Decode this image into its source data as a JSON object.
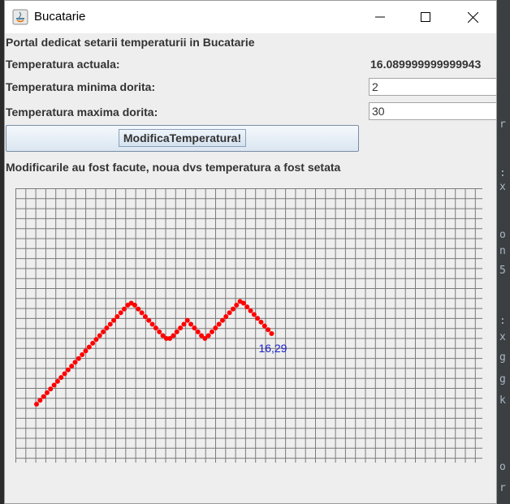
{
  "window": {
    "title": "Bucatarie",
    "buttons": [
      "minimize-icon",
      "maximize-icon",
      "close-icon"
    ]
  },
  "header": "Portal dedicat setarii temperaturii in Bucatarie",
  "current_temp": {
    "label": "Temperatura actuala:",
    "value": "16.089999999999943"
  },
  "min_temp": {
    "label": "Temperatura minima dorita:",
    "value": "2"
  },
  "max_temp": {
    "label": "Temperatura maxima dorita:",
    "value": "30"
  },
  "button": {
    "label": "ModificaTemperatura!"
  },
  "status": "Modificarile au fost facute, noua dvs temperatura a fost setata",
  "colors": {
    "point": "#ff0000",
    "label": "#1a22cc",
    "grid": "#7a7a7a",
    "window_bg": "#eeeeee"
  },
  "chart_data": {
    "type": "line",
    "grid": true,
    "series": [
      {
        "values": [
          0.0,
          0.55,
          1.1,
          1.65,
          2.2,
          2.75,
          3.3,
          3.85,
          4.4,
          4.95,
          5.5,
          6.05,
          6.6,
          7.15,
          7.7,
          8.25,
          8.8,
          9.35,
          9.9,
          10.45,
          11.0,
          11.55,
          12.1,
          12.65,
          13.2,
          13.75,
          14.3,
          14.6,
          14.3,
          13.75,
          13.2,
          12.65,
          12.1,
          11.55,
          11.0,
          10.45,
          9.9,
          9.5,
          9.5,
          9.9,
          10.45,
          11.0,
          11.55,
          12.1,
          11.55,
          11.0,
          10.45,
          9.9,
          9.5,
          9.9,
          10.45,
          11.0,
          11.55,
          12.1,
          12.65,
          13.2,
          13.75,
          14.3,
          14.85,
          14.6,
          14.05,
          13.5,
          12.95,
          12.4,
          11.85,
          11.3,
          10.75,
          10.2
        ]
      }
    ],
    "annotation": "16,29"
  }
}
